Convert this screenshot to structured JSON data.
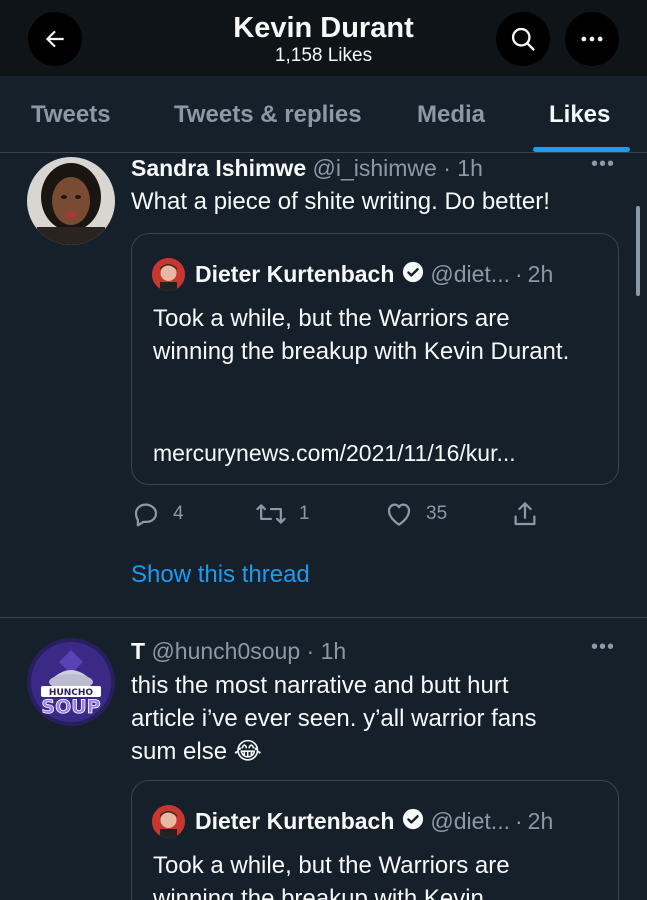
{
  "header": {
    "title": "Kevin Durant",
    "subtitle": "1,158 Likes",
    "back_icon": "arrow-left-icon",
    "search_icon": "search-icon",
    "more_icon": "more-horizontal-icon"
  },
  "tabs": [
    {
      "label": "Tweets",
      "active": false
    },
    {
      "label": "Tweets & replies",
      "active": false
    },
    {
      "label": "Media",
      "active": false
    },
    {
      "label": "Likes",
      "active": true
    }
  ],
  "colors": {
    "background": "#15202b",
    "header_bg": "#0f1419",
    "accent": "#1d9bf0",
    "muted": "#8b98a5",
    "border": "#38444d"
  },
  "tweets": [
    {
      "name": "Sandra Ishimwe",
      "handle": "@i_ishimwe",
      "dot": "·",
      "time": "1h",
      "text": "What a piece of shite writing. Do better!",
      "quote": {
        "name": "Dieter Kurtenbach",
        "handle": "@diet...",
        "dot": "·",
        "time": "2h",
        "text": "Took a while, but the Warriors are winning the breakup with Kevin Durant.",
        "link": "mercurynews.com/2021/11/16/kur..."
      },
      "actions": {
        "replies": "4",
        "retweets": "1",
        "likes": "35"
      },
      "show_thread": "Show this thread"
    },
    {
      "name": "T",
      "handle": "@hunch0soup",
      "dot": "·",
      "time": "1h",
      "text": "this the most narrative and butt hurt article i’ve ever seen. y’all warrior fans sum else 😂",
      "avatar_text": {
        "top": "HUNCHO",
        "bottom": "SOUP"
      },
      "quote": {
        "name": "Dieter Kurtenbach",
        "handle": "@diet...",
        "dot": "·",
        "time": "2h",
        "text": "Took a while, but the Warriors are winning the breakup with Kevin"
      }
    }
  ]
}
